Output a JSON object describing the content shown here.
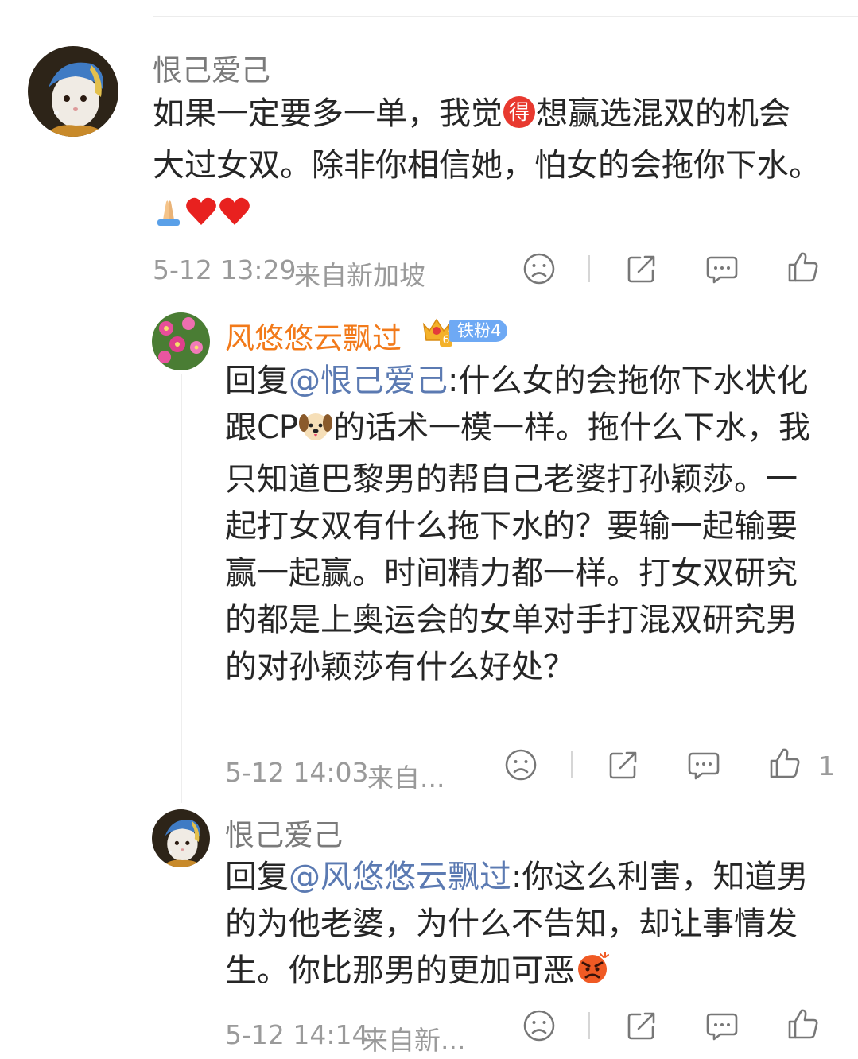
{
  "comment": {
    "username": "恨己爱己",
    "text": "如果一定要多一单，我觉",
    "text_badge_char": "得",
    "text_rest": "想赢选混双的机会大过女双。除非你相信她，怕女的会拖你下水。",
    "time": "5-12 13:29",
    "location": "来自新加坡"
  },
  "reply1": {
    "username": "风悠悠云飘过",
    "fan_badge": "铁粉4",
    "crown_level": "6",
    "reply_prefix": "回复",
    "mention": "@恨己爱己",
    "text_before_emoji": ":什么女的会拖你下水状化跟CP",
    "text_after_emoji": "的话术一模一样。拖什么下水，我只知道巴黎男的帮自己老婆打孙颖莎。一起打女双有什么拖下水的？要输一起输要赢一起赢。时间精力都一样。打女双研究的都是上奥运会的女单对手打混双研究男的对孙颖莎有什么好处？",
    "time": "5-12 14:03",
    "location": "来自...",
    "like_count": "1"
  },
  "reply2": {
    "username": "恨己爱己",
    "reply_prefix": "回复",
    "mention": "@风悠悠云飘过",
    "text": ":你这么利害，知道男的为他老婆，为什么不告知，却让事情发生。你比那男的更加可恶",
    "time": "5-12 14:14",
    "location": "来自新..."
  },
  "icons": {
    "dislike": "frown-face-icon",
    "repost": "share-box-icon",
    "comment": "speech-bubble-icon",
    "like": "thumbs-up-icon"
  },
  "colors": {
    "mention": "#5b7ab2",
    "username_orange": "#f27a1a",
    "badge_blue": "#6ea9f4",
    "meta_gray": "#9a9a9a"
  }
}
